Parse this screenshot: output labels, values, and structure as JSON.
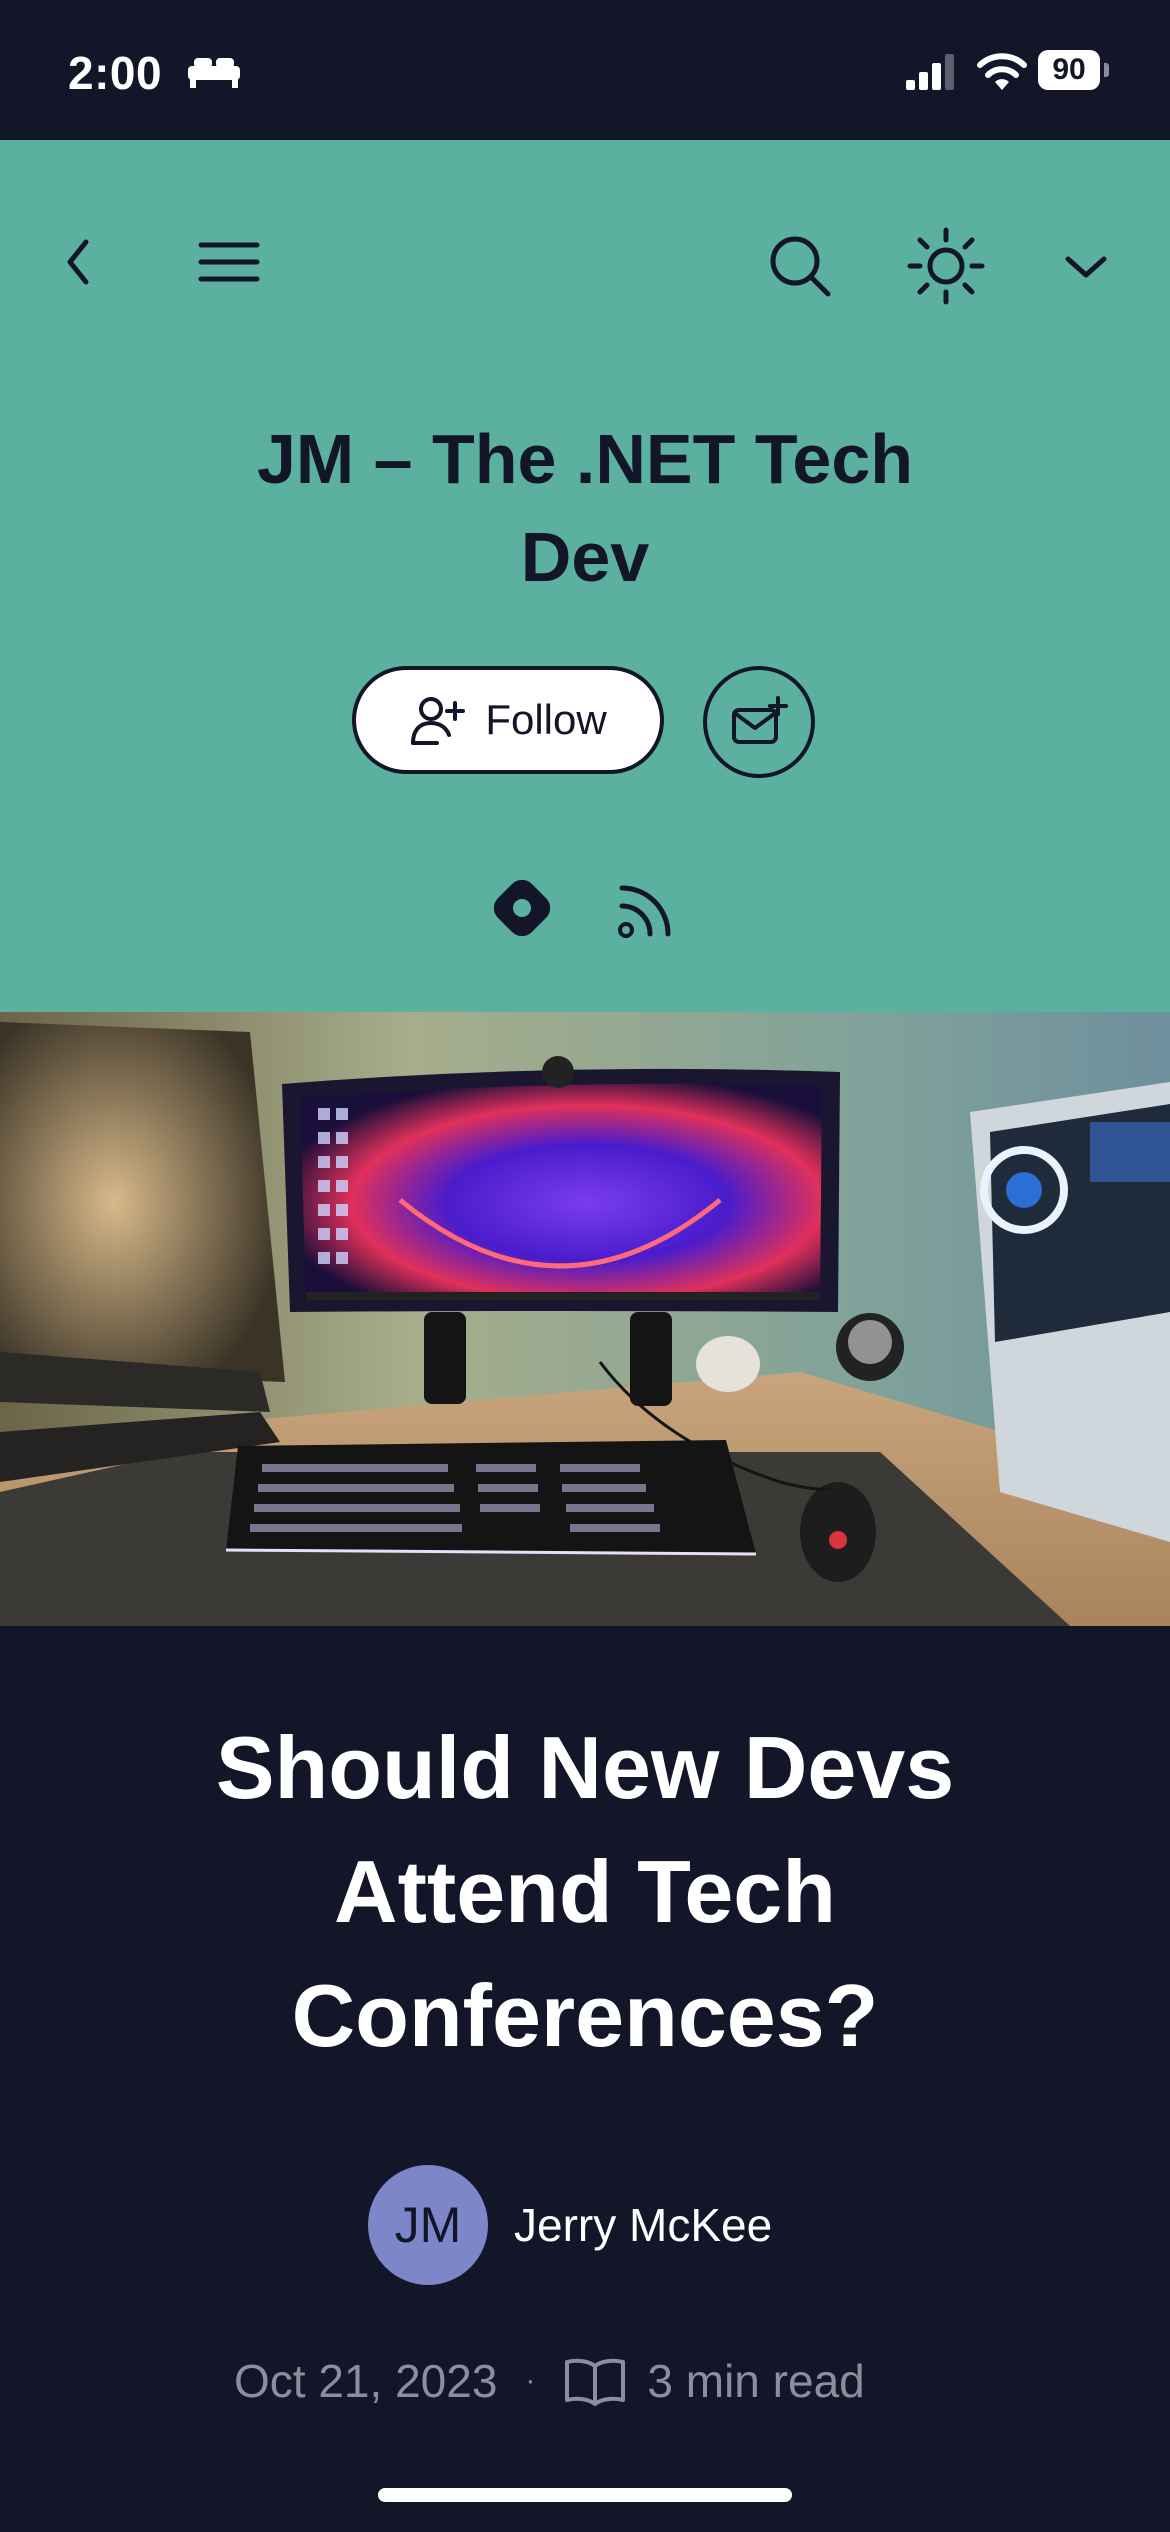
{
  "status_bar": {
    "time": "2:00",
    "battery": "90",
    "icons": [
      "sleep-focus-icon",
      "cellular-signal-icon",
      "wifi-icon",
      "battery-icon"
    ]
  },
  "nav": {
    "icons": [
      "chevron-left-icon",
      "hamburger-menu-icon",
      "search-icon",
      "sun-icon",
      "chevron-down-icon"
    ]
  },
  "blog": {
    "title": "JM – The .NET Tech Dev",
    "follow_label": "Follow",
    "newsletter_icon": "envelope-plus-icon",
    "social_icons": [
      "hashnode-icon",
      "rss-icon"
    ]
  },
  "article": {
    "title": "Should New Devs Attend Tech Conferences?",
    "author_initials": "JM",
    "author_name": "Jerry McKee",
    "date": "Oct 21, 2023",
    "separator": "·",
    "read_time": "3 min read"
  },
  "colors": {
    "header_bg": "#5bb0a0",
    "page_bg": "#121628",
    "avatar_bg": "#7d86c8"
  }
}
